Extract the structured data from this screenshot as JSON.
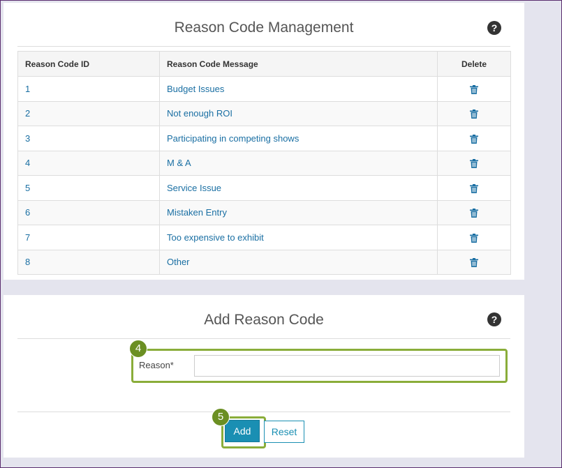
{
  "management": {
    "title": "Reason Code Management",
    "help_glyph": "?",
    "columns": [
      "Reason Code ID",
      "Reason Code Message",
      "Delete"
    ],
    "rows": [
      {
        "id": "1",
        "message": "Budget Issues"
      },
      {
        "id": "2",
        "message": "Not enough ROI"
      },
      {
        "id": "3",
        "message": "Participating in competing shows"
      },
      {
        "id": "4",
        "message": "M & A"
      },
      {
        "id": "5",
        "message": "Service Issue"
      },
      {
        "id": "6",
        "message": "Mistaken Entry"
      },
      {
        "id": "7",
        "message": "Too expensive to exhibit"
      },
      {
        "id": "8",
        "message": "Other"
      }
    ],
    "delete_icon": "trash-icon"
  },
  "add_form": {
    "title": "Add Reason Code",
    "help_glyph": "?",
    "reason_label": "Reason*",
    "reason_value": "",
    "reason_placeholder": "",
    "add_label": "Add",
    "reset_label": "Reset"
  },
  "callouts": {
    "step4": "4",
    "step5": "5"
  },
  "colors": {
    "accent": "#1a8fb3",
    "link": "#1a6fa3",
    "highlight": "#8aad3a",
    "badge": "#6b8f23"
  }
}
